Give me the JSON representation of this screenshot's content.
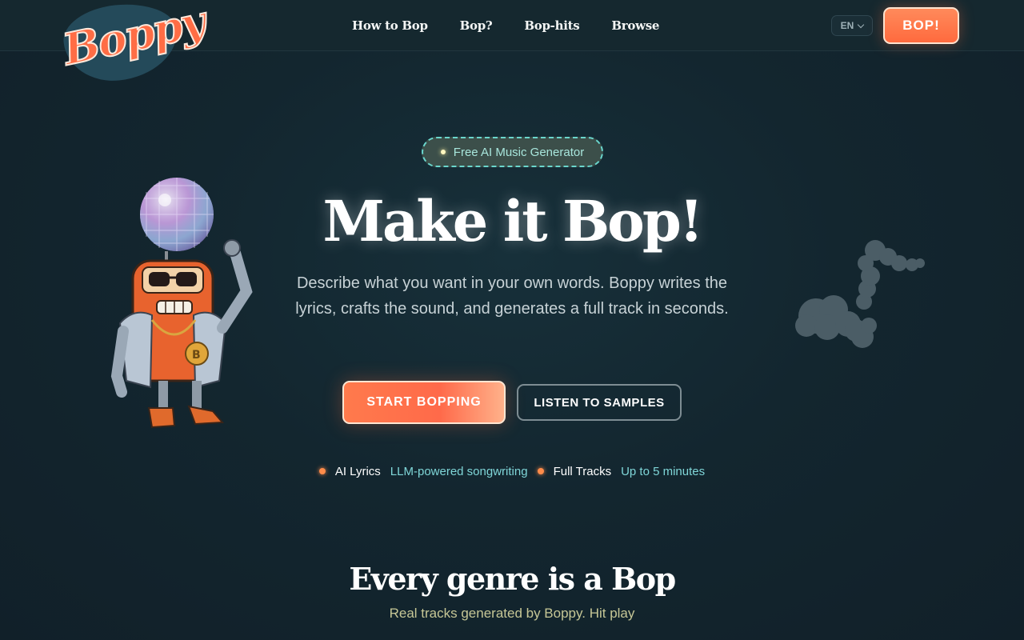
{
  "brand": {
    "name": "Boppy",
    "colors": {
      "accent": "#ff6a3e",
      "background": "#13262f",
      "teal": "#7fd6d8"
    }
  },
  "nav": {
    "items": [
      {
        "label": "How to Bop"
      },
      {
        "label": "Bop?"
      },
      {
        "label": "Bop-hits"
      },
      {
        "label": "Browse"
      }
    ],
    "language": "EN",
    "cta_label": "BOP!"
  },
  "hero": {
    "badge": "Free AI Music Generator",
    "title": "Make it Bop!",
    "description": "Describe what you want in your own words. Boppy writes the lyrics, crafts the sound, and generates a full track in seconds.",
    "primary_button": "START BOPPING",
    "secondary_button": "LISTEN TO SAMPLES",
    "features": [
      {
        "name": "AI Lyrics",
        "detail": "LLM-powered songwriting"
      },
      {
        "name": "Full Tracks",
        "detail": "Up to 5 minutes"
      }
    ]
  },
  "genres": {
    "title": "Every genre is a Bop",
    "subtitle": "Real tracks generated by Boppy. Hit play"
  },
  "icons": [
    "boppy-logo-icon",
    "chevron-down-icon",
    "disco-ball-icon",
    "robot-mascot-icon",
    "smoke-music-note-icon"
  ]
}
